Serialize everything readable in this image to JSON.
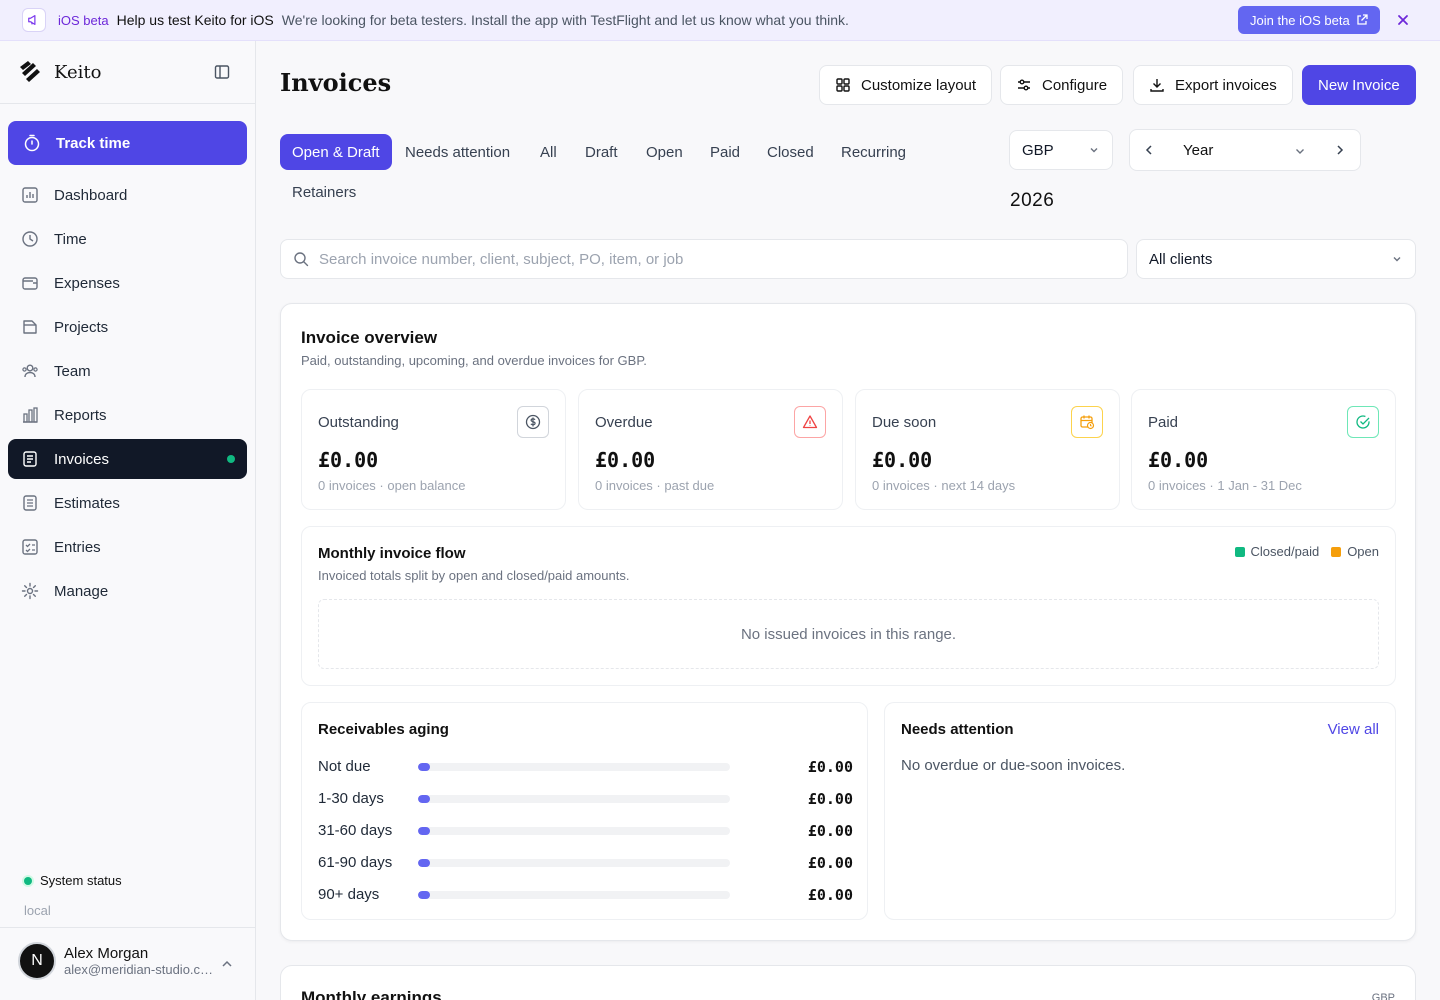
{
  "banner": {
    "tag": "iOS beta",
    "headline": "Help us test Keito for iOS",
    "description": "We're looking for beta testers. Install the app with TestFlight and let us know what you think.",
    "join_label": "Join the iOS beta"
  },
  "sidebar": {
    "brand": "Keito",
    "track_time": "Track time",
    "items": [
      {
        "label": "Dashboard",
        "icon": "dashboard-icon"
      },
      {
        "label": "Time",
        "icon": "clock-icon"
      },
      {
        "label": "Expenses",
        "icon": "wallet-icon"
      },
      {
        "label": "Projects",
        "icon": "folder-icon"
      },
      {
        "label": "Team",
        "icon": "users-icon"
      },
      {
        "label": "Reports",
        "icon": "bar-chart-icon"
      },
      {
        "label": "Invoices",
        "icon": "invoice-icon",
        "active": true
      },
      {
        "label": "Estimates",
        "icon": "estimate-icon"
      },
      {
        "label": "Entries",
        "icon": "entries-icon"
      },
      {
        "label": "Manage",
        "icon": "gear-icon"
      }
    ],
    "system_status": "System status",
    "environment": "local",
    "user": {
      "initial": "N",
      "name": "Alex Morgan",
      "email": "alex@meridian-studio.com"
    }
  },
  "header": {
    "title": "Invoices",
    "customize_label": "Customize layout",
    "configure_label": "Configure",
    "export_label": "Export invoices",
    "new_label": "New Invoice"
  },
  "tabs": [
    "Open & Draft",
    "Needs attention",
    "All",
    "Draft",
    "Open",
    "Paid",
    "Closed",
    "Recurring",
    "Retainers"
  ],
  "filters": {
    "currency": "GBP",
    "period": "Year",
    "year": "2026",
    "search_placeholder": "Search invoice number, client, subject, PO, item, or job",
    "clients": "All clients"
  },
  "overview": {
    "title": "Invoice overview",
    "subtitle": "Paid, outstanding, upcoming, and overdue invoices for GBP.",
    "kpis": [
      {
        "label": "Outstanding",
        "value": "£0.00",
        "sub": "0 invoices · open balance",
        "icon": "dollar-circle-icon",
        "color": "#6b7280"
      },
      {
        "label": "Overdue",
        "value": "£0.00",
        "sub": "0 invoices · past due",
        "icon": "warning-icon",
        "color": "#ef4444"
      },
      {
        "label": "Due soon",
        "value": "£0.00",
        "sub": "0 invoices · next 14 days",
        "icon": "calendar-clock-icon",
        "color": "#f59e0b"
      },
      {
        "label": "Paid",
        "value": "£0.00",
        "sub": "0 invoices · 1 Jan - 31 Dec",
        "icon": "check-circle-icon",
        "color": "#10b981"
      }
    ],
    "flow": {
      "title": "Monthly invoice flow",
      "subtitle": "Invoiced totals split by open and closed/paid amounts.",
      "legend": [
        {
          "label": "Closed/paid",
          "color": "#10b981"
        },
        {
          "label": "Open",
          "color": "#f59e0b"
        }
      ],
      "empty": "No issued invoices in this range."
    },
    "aging": {
      "title": "Receivables aging",
      "rows": [
        {
          "label": "Not due",
          "value": "£0.00",
          "fraction": 0
        },
        {
          "label": "1-30 days",
          "value": "£0.00",
          "fraction": 0
        },
        {
          "label": "31-60 days",
          "value": "£0.00",
          "fraction": 0
        },
        {
          "label": "61-90 days",
          "value": "£0.00",
          "fraction": 0
        },
        {
          "label": "90+ days",
          "value": "£0.00",
          "fraction": 0
        }
      ]
    },
    "attention": {
      "title": "Needs attention",
      "view_all": "View all",
      "empty": "No overdue or due-soon invoices."
    }
  },
  "earnings": {
    "title": "Monthly earnings",
    "currency": "GBP"
  }
}
